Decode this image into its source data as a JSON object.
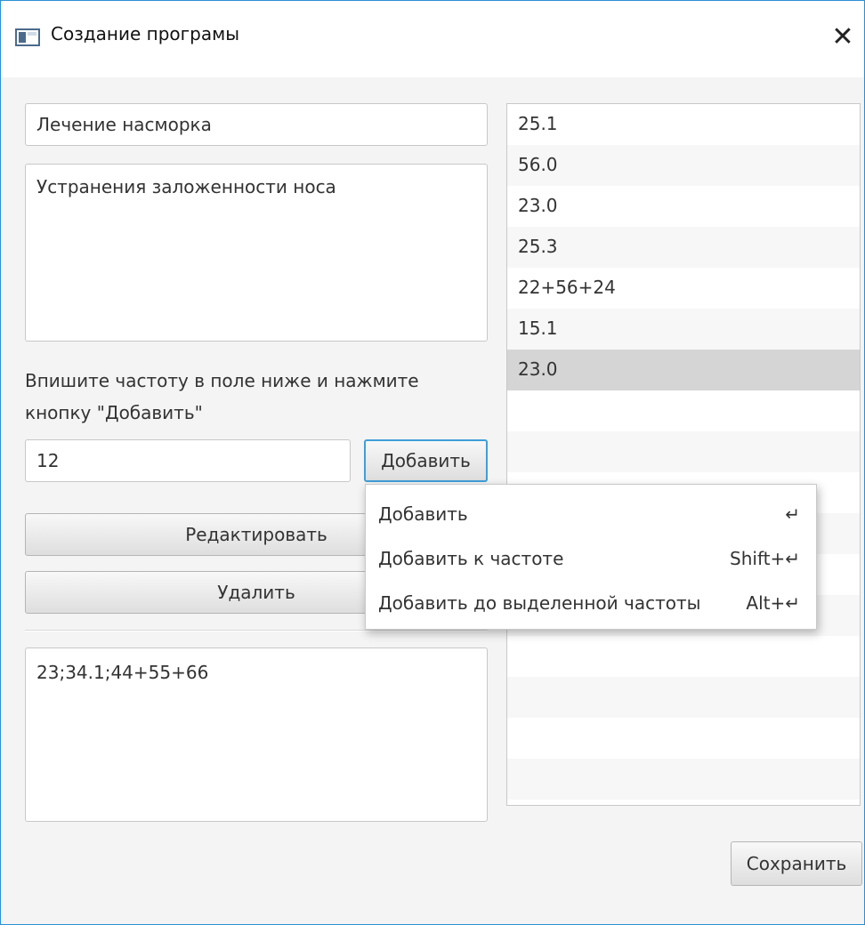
{
  "window": {
    "title": "Создание програмы",
    "close_glyph": "✕"
  },
  "form": {
    "name_value": "Лечение насморка",
    "description_value": "Устранения заложенности носа",
    "hint_line1": "Впишите частоту в поле ниже и нажмите",
    "hint_line2": "кнопку \"Добавить\"",
    "frequency_input_value": "12",
    "add_button_label": "Добавить",
    "edit_button_label": "Редактировать",
    "delete_button_label": "Удалить",
    "bulk_frequencies_value": "23;34.1;44+55+66",
    "save_button_label": "Сохранить"
  },
  "frequency_list": {
    "items": [
      "25.1",
      "56.0",
      "23.0",
      "25.3",
      "22+56+24",
      "15.1",
      "23.0"
    ],
    "selected_index": 6
  },
  "context_menu": {
    "items": [
      {
        "label": "Добавить",
        "accelerator": "↵"
      },
      {
        "label": "Добавить к частоте",
        "accelerator": "Shift+↵"
      },
      {
        "label": "Добавить до выделенной частоты",
        "accelerator": "Alt+↵"
      }
    ]
  },
  "icons": {
    "app_icon": "window-app-icon",
    "close_icon": "close-icon"
  }
}
